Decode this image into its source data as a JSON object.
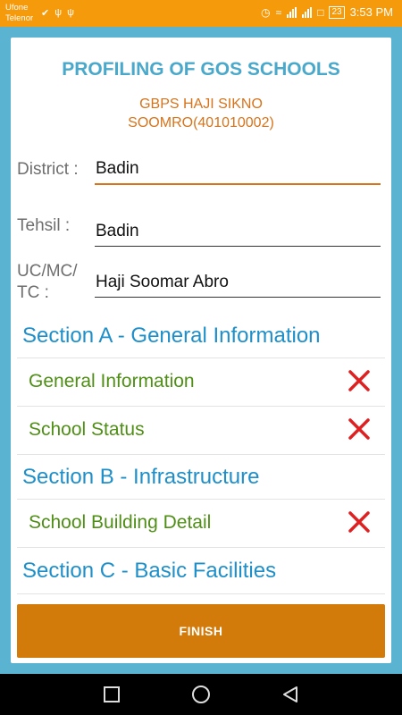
{
  "status_bar": {
    "carrier_1": "Ufone",
    "carrier_2": "Telenor",
    "battery": "23",
    "time": "3:53 PM"
  },
  "header": {
    "title": "PROFILING OF GOS SCHOOLS",
    "school_line_1": "GBPS HAJI SIKNO",
    "school_line_2": "SOOMRO(401010002)"
  },
  "fields": {
    "district": {
      "label": "District :",
      "value": "Badin"
    },
    "tehsil": {
      "label": "Tehsil :",
      "value": "Badin"
    },
    "uc": {
      "label_1": "UC/MC/",
      "label_2": "TC :",
      "value": "Haji Soomar Abro"
    }
  },
  "sections": {
    "a": {
      "title": "Section A - General Information",
      "items": [
        "General Information",
        "School Status"
      ]
    },
    "b": {
      "title": "Section B - Infrastructure",
      "items": [
        "School Building Detail"
      ]
    },
    "c": {
      "title": "Section C - Basic Facilities"
    }
  },
  "finish_label": "FINISH",
  "colors": {
    "status_bar": "#f59a0a",
    "title": "#4aa9cb",
    "subtitle": "#d7731a",
    "section": "#1e8fc9",
    "item": "#4f8f16",
    "button": "#d27a0a",
    "incomplete_mark": "#e02020"
  },
  "icons": {
    "item_status": "red-x-icon",
    "nav": [
      "square-recents-icon",
      "circle-home-icon",
      "triangle-back-icon"
    ]
  }
}
